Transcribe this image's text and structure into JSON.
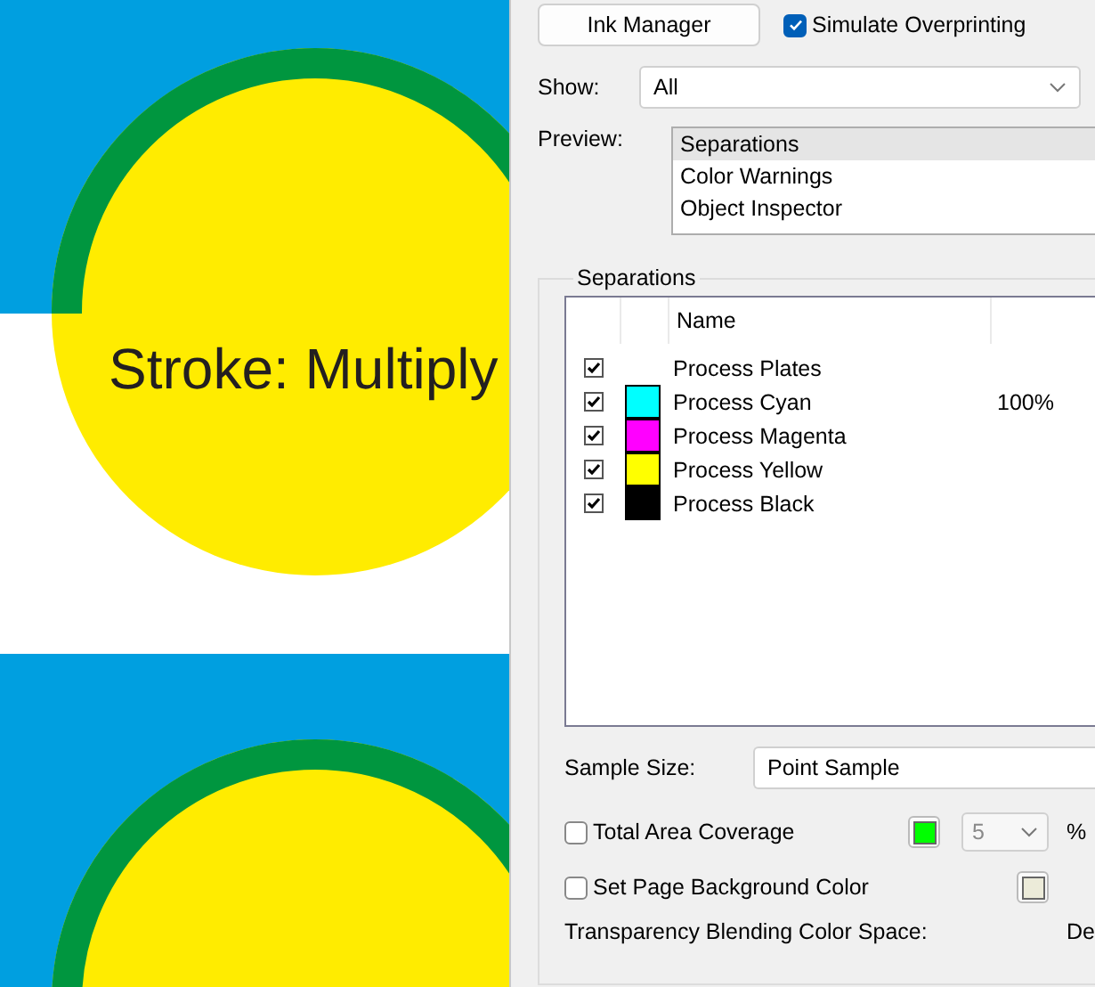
{
  "artwork": {
    "label": "Stroke: Multiply"
  },
  "panel": {
    "ink_manager_button": "Ink Manager",
    "simulate_overprinting": {
      "label": "Simulate Overprinting",
      "checked": true
    },
    "show": {
      "label": "Show:",
      "value": "All"
    },
    "preview": {
      "label": "Preview:",
      "items": [
        {
          "label": "Separations",
          "selected": true
        },
        {
          "label": "Color Warnings",
          "selected": false
        },
        {
          "label": "Object Inspector",
          "selected": false
        }
      ]
    },
    "separations": {
      "title": "Separations",
      "columns": [
        "Name"
      ],
      "rows": [
        {
          "name": "Process Plates",
          "checked": true
        },
        {
          "name": "Process Cyan",
          "checked": true,
          "color": "#00ffff",
          "column_4": "100%"
        },
        {
          "name": "Process Magenta",
          "checked": true,
          "color": "#ff00ff"
        },
        {
          "name": "Process Yellow",
          "checked": true,
          "color": "#ffff00"
        },
        {
          "name": "Process Black",
          "checked": true,
          "color": "#000000"
        }
      ],
      "sample_size": {
        "label": "Sample Size:",
        "value": "Point Sample"
      },
      "total_area_coverage": {
        "label": "Total Area Coverage",
        "checked": false,
        "color": "#00ff00",
        "value": "5",
        "disabled": true,
        "unit": "%"
      },
      "page_background": {
        "label": "Set Page Background Color",
        "checked": false,
        "color": "#ecebd9"
      },
      "blending": {
        "label": "Transparency Blending Color Space:",
        "value": "De"
      }
    }
  }
}
